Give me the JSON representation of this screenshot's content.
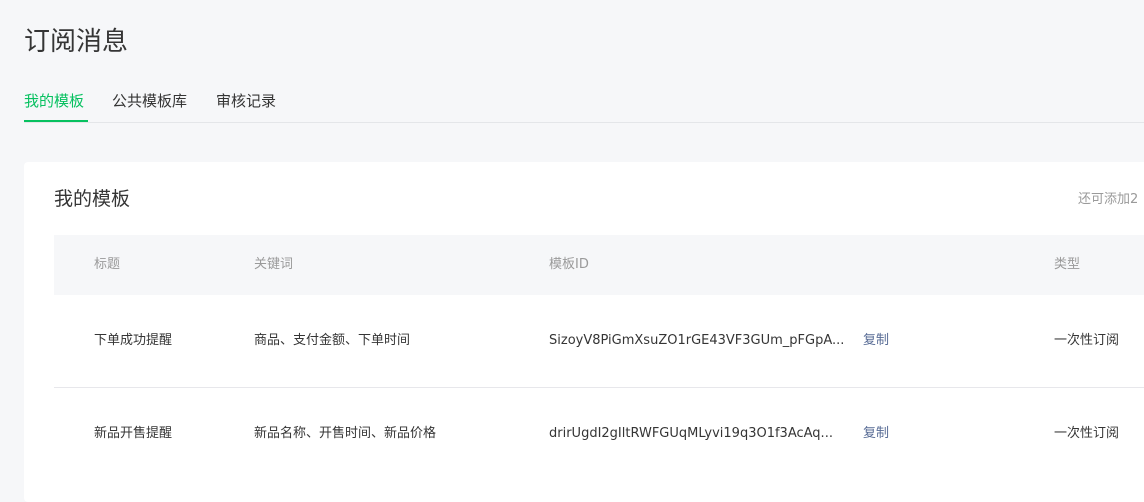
{
  "page": {
    "title": "订阅消息"
  },
  "tabs": [
    {
      "label": "我的模板",
      "active": true
    },
    {
      "label": "公共模板库",
      "active": false
    },
    {
      "label": "审核记录",
      "active": false
    }
  ],
  "card": {
    "title": "我的模板",
    "quota_hint": "还可添加2"
  },
  "table": {
    "headers": {
      "title": "标题",
      "keywords": "关键词",
      "template_id": "模板ID",
      "type": "类型"
    },
    "rows": [
      {
        "title": "下单成功提醒",
        "keywords": "商品、支付金额、下单时间",
        "template_id": "SizoyV8PiGmXsuZO1rGE43VF3GUm_pFGpA...",
        "copy_label": "复制",
        "type": "一次性订阅"
      },
      {
        "title": "新品开售提醒",
        "keywords": "新品名称、开售时间、新品价格",
        "template_id": "drirUgdI2gIltRWFGUqMLyvi19q3O1f3AcAq...",
        "copy_label": "复制",
        "type": "一次性订阅"
      }
    ]
  },
  "colors": {
    "accent": "#07c160",
    "link": "#576b95",
    "muted": "#9a9a9a",
    "background": "#f6f7f9"
  }
}
